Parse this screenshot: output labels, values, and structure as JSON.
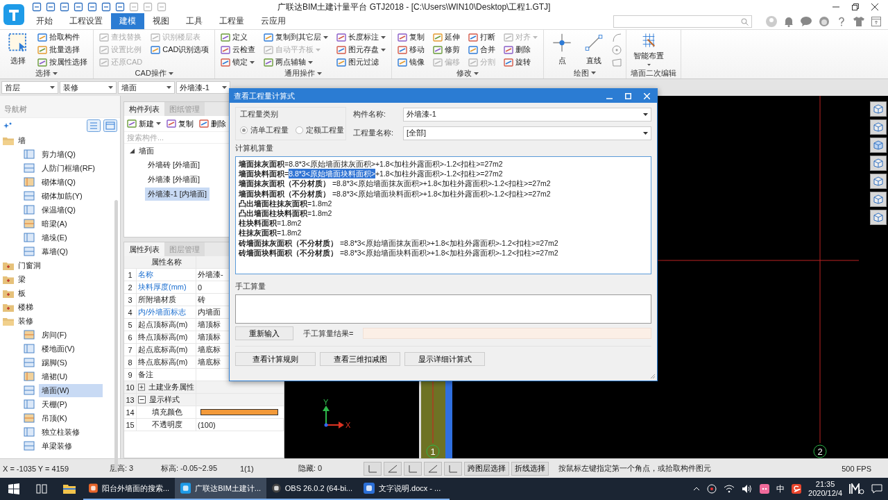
{
  "app": {
    "title": "广联达BIM土建计量平台 GTJ2018 - [C:\\Users\\WIN10\\Desktop\\工程1.GTJ]"
  },
  "menu_tabs": [
    {
      "label": "开始",
      "selected": false
    },
    {
      "label": "工程设置",
      "selected": false
    },
    {
      "label": "建模",
      "selected": true
    },
    {
      "label": "视图",
      "selected": false
    },
    {
      "label": "工具",
      "selected": false
    },
    {
      "label": "工程量",
      "selected": false
    },
    {
      "label": "云应用",
      "selected": false
    }
  ],
  "ribbon": [
    {
      "label": "选择",
      "dropdown": true,
      "big": [
        {
          "label": "选择",
          "dropdown": false
        }
      ],
      "small": [
        {
          "label": "拾取构件",
          "disabled": false,
          "dropdown": false
        },
        {
          "label": "批量选择",
          "disabled": false,
          "dropdown": false
        },
        {
          "label": "按属性选择",
          "disabled": false,
          "dropdown": false
        }
      ],
      "shape_tools": false
    },
    {
      "label": "CAD操作",
      "dropdown": true,
      "small": [
        {
          "label": "查找替换",
          "disabled": true,
          "dropdown": false
        },
        {
          "label": "设置比例",
          "disabled": true,
          "dropdown": false
        },
        {
          "label": "还原CAD",
          "disabled": true,
          "dropdown": false
        },
        {
          "label": "识别楼层表",
          "disabled": true,
          "dropdown": false
        },
        {
          "label": "CAD识别选项",
          "disabled": false,
          "dropdown": false
        }
      ],
      "shape_tools": false
    },
    {
      "label": "通用操作",
      "dropdown": true,
      "small": [
        {
          "label": "定义",
          "disabled": false,
          "dropdown": false
        },
        {
          "label": "云检查",
          "disabled": false,
          "dropdown": false
        },
        {
          "label": "锁定",
          "disabled": false,
          "dropdown": true
        },
        {
          "label": "复制到其它层",
          "disabled": false,
          "dropdown": true
        },
        {
          "label": "自动平齐板",
          "disabled": true,
          "dropdown": true
        },
        {
          "label": "两点辅轴",
          "disabled": false,
          "dropdown": true
        },
        {
          "label": "长度标注",
          "disabled": false,
          "dropdown": true
        },
        {
          "label": "图元存盘",
          "disabled": false,
          "dropdown": true
        },
        {
          "label": "图元过滤",
          "disabled": false,
          "dropdown": false
        }
      ],
      "shape_tools": false
    },
    {
      "label": "修改",
      "dropdown": true,
      "small": [
        {
          "label": "复制",
          "disabled": false,
          "dropdown": false
        },
        {
          "label": "移动",
          "disabled": false,
          "dropdown": false
        },
        {
          "label": "镜像",
          "disabled": false,
          "dropdown": false
        },
        {
          "label": "延伸",
          "disabled": false,
          "dropdown": false
        },
        {
          "label": "修剪",
          "disabled": false,
          "dropdown": false
        },
        {
          "label": "偏移",
          "disabled": true,
          "dropdown": false
        },
        {
          "label": "打断",
          "disabled": false,
          "dropdown": false
        },
        {
          "label": "合并",
          "disabled": false,
          "dropdown": false
        },
        {
          "label": "分割",
          "disabled": true,
          "dropdown": false
        },
        {
          "label": "对齐",
          "disabled": true,
          "dropdown": true
        },
        {
          "label": "删除",
          "disabled": false,
          "dropdown": false
        },
        {
          "label": "旋转",
          "disabled": false,
          "dropdown": false
        }
      ],
      "shape_tools": false
    },
    {
      "label": "绘图",
      "dropdown": true,
      "big": [
        {
          "label": "点",
          "dropdown": false
        },
        {
          "label": "直线",
          "dropdown": false
        }
      ],
      "shape_tools": true
    },
    {
      "label": "墙面二次编辑",
      "dropdown": false,
      "big": [
        {
          "label": "智能布置",
          "dropdown": true
        }
      ],
      "shape_tools": false
    }
  ],
  "selectors": [
    {
      "value": "首层"
    },
    {
      "value": "装修"
    },
    {
      "value": "墙面"
    },
    {
      "value": "外墙漆-1"
    }
  ],
  "nav_tree": {
    "title": "导航树",
    "items": [
      {
        "label": "墙",
        "expanded": true,
        "children": [
          {
            "label": "剪力墙(Q)",
            "selected": false
          },
          {
            "label": "人防门框墙(RF)",
            "selected": false
          },
          {
            "label": "砌体墙(Q)",
            "selected": false
          },
          {
            "label": "砌体加筋(Y)",
            "selected": false
          },
          {
            "label": "保温墙(Q)",
            "selected": false
          },
          {
            "label": "暗梁(A)",
            "selected": false
          },
          {
            "label": "墙垛(E)",
            "selected": false
          },
          {
            "label": "幕墙(Q)",
            "selected": false
          }
        ]
      },
      {
        "label": "门窗洞",
        "expanded": false
      },
      {
        "label": "梁",
        "expanded": false
      },
      {
        "label": "板",
        "expanded": false
      },
      {
        "label": "楼梯",
        "expanded": false
      },
      {
        "label": "装修",
        "expanded": true,
        "children": [
          {
            "label": "房间(F)",
            "selected": false
          },
          {
            "label": "楼地面(V)",
            "selected": false
          },
          {
            "label": "踢脚(S)",
            "selected": false
          },
          {
            "label": "墙裙(U)",
            "selected": false
          },
          {
            "label": "墙面(W)",
            "selected": true
          },
          {
            "label": "天棚(P)",
            "selected": false
          },
          {
            "label": "吊顶(K)",
            "selected": false
          },
          {
            "label": "独立柱装修",
            "selected": false
          },
          {
            "label": "单梁装修",
            "selected": false
          }
        ]
      }
    ]
  },
  "component_panel": {
    "tabs": [
      {
        "label": "构件列表",
        "selected": true
      },
      {
        "label": "图纸管理",
        "selected": false
      }
    ],
    "toolbar": [
      {
        "label": "新建",
        "dropdown": true
      },
      {
        "label": "复制",
        "dropdown": false
      },
      {
        "label": "删除",
        "dropdown": false
      }
    ],
    "search": {
      "placeholder": "搜索构件..."
    },
    "tree": [
      {
        "label": "墙面",
        "expanded": true,
        "children": [
          {
            "label": "外墙砖 [外墙面]",
            "selected": false
          },
          {
            "label": "外墙漆 [外墙面]",
            "selected": false
          },
          {
            "label": "外墙漆-1 [内墙面]",
            "selected": true
          }
        ]
      }
    ]
  },
  "property_panel": {
    "tabs": [
      {
        "label": "属性列表",
        "selected": true
      },
      {
        "label": "图层管理",
        "selected": false
      }
    ],
    "header": "属性名称",
    "rows": [
      {
        "kind": "attr",
        "num": "1",
        "name": "名称",
        "value": "外墙漆-",
        "emphasized": true
      },
      {
        "kind": "attr",
        "num": "2",
        "name": "块料厚度(mm)",
        "value": "0",
        "emphasized": true
      },
      {
        "kind": "attr",
        "num": "3",
        "name": "所附墙材质",
        "value": "砖",
        "emphasized": false
      },
      {
        "kind": "attr",
        "num": "4",
        "name": "内/外墙面标志",
        "value": "内墙面",
        "emphasized": true
      },
      {
        "kind": "attr",
        "num": "5",
        "name": "起点顶标高(m)",
        "value": "墙顶标",
        "emphasized": false
      },
      {
        "kind": "attr",
        "num": "6",
        "name": "终点顶标高(m)",
        "value": "墙顶标",
        "emphasized": false
      },
      {
        "kind": "attr",
        "num": "7",
        "name": "起点底标高(m)",
        "value": "墙底标",
        "emphasized": false
      },
      {
        "kind": "attr",
        "num": "8",
        "name": "终点底标高(m)",
        "value": "墙底标",
        "emphasized": false
      },
      {
        "kind": "attr",
        "num": "9",
        "name": "备注",
        "emphasized": false
      },
      {
        "kind": "group",
        "num": "10",
        "name": "土建业务属性",
        "expanded": false
      },
      {
        "kind": "group",
        "num": "13",
        "name": "显示样式",
        "expanded": true
      },
      {
        "kind": "color",
        "num": "14",
        "name": "填充颜色",
        "color": "#f39a3a"
      },
      {
        "kind": "sub",
        "num": "15",
        "name": "不透明度",
        "value": "(100)"
      }
    ]
  },
  "canvas": {
    "axis_labels": [
      "1",
      "2"
    ],
    "ucs": {
      "x": "X",
      "y": "Y"
    }
  },
  "dialog": {
    "title": "查看工程量计算式",
    "category": {
      "label": "工程量类别",
      "options": [
        {
          "label": "清单工程量",
          "selected": true
        },
        {
          "label": "定额工程量",
          "selected": false
        }
      ]
    },
    "fields": [
      {
        "label": "构件名称:",
        "value": "外墙漆-1"
      },
      {
        "label": "工程量名称:",
        "value": "[全部]"
      }
    ],
    "computed_label": "计算机算量",
    "computed_lines": [
      {
        "label": "墙面抹灰面积",
        "segments": [
          {
            "text": "=8.8*3<原始墙面抹灰面积>+1.8<加柱外露面积>-1.2<扣柱>=27m2",
            "selected": false
          }
        ]
      },
      {
        "label": "墙面块料面积",
        "segments": [
          {
            "text": "=",
            "selected": false
          },
          {
            "text": "8.8*3<原始墙面块料面积>",
            "selected": true
          },
          {
            "text": "+1.8<加柱外露面积>-1.2<扣柱>=27m2",
            "selected": false
          }
        ]
      },
      {
        "label": "墙面抹灰面积（不分材质）",
        "segments": [
          {
            "text": " =8.8*3<原始墙面抹灰面积>+1.8<加柱外露面积>-1.2<扣柱>=27m2",
            "selected": false
          }
        ]
      },
      {
        "label": "墙面块料面积（不分材质）",
        "segments": [
          {
            "text": " =8.8*3<原始墙面块料面积>+1.8<加柱外露面积>-1.2<扣柱>=27m2",
            "selected": false
          }
        ]
      },
      {
        "label": "凸出墙面柱抹灰面积",
        "segments": [
          {
            "text": "=1.8m2",
            "selected": false
          }
        ]
      },
      {
        "label": "凸出墙面柱块料面积",
        "segments": [
          {
            "text": "=1.8m2",
            "selected": false
          }
        ]
      },
      {
        "label": "柱块料面积",
        "segments": [
          {
            "text": "=1.8m2",
            "selected": false
          }
        ]
      },
      {
        "label": "柱抹灰面积",
        "segments": [
          {
            "text": "=1.8m2",
            "selected": false
          }
        ]
      },
      {
        "label": "砖墙面抹灰面积（不分材质）",
        "segments": [
          {
            "text": " =8.8*3<原始墙面抹灰面积>+1.8<加柱外露面积>-1.2<扣柱>=27m2",
            "selected": false
          }
        ]
      },
      {
        "label": "砖墙面块料面积（不分材质）",
        "segments": [
          {
            "text": " =8.8*3<原始墙面块料面积>+1.8<加柱外露面积>-1.2<扣柱>=27m2",
            "selected": false
          }
        ]
      }
    ],
    "manual_label": "手工算量",
    "reset_button": "重新输入",
    "result_label": "手工算量结果=",
    "buttons": [
      "查看计算规则",
      "查看三维扣减图",
      "显示详细计算式"
    ]
  },
  "status_bar": {
    "coords": "X = -1035 Y = 4159",
    "floor_height": "层高:  3",
    "elevation": "标高:  -0.05~2.95",
    "count": "1(1)",
    "hidden": "隐藏:  0",
    "buttons": [
      "跨图层选择",
      "折线选择"
    ],
    "hint": "按鼠标左键指定第一个角点，或拾取构件图元",
    "fps": "500 FPS"
  },
  "taskbar": {
    "apps": [
      {
        "label": "阳台外墙面的搜索...",
        "selected": false
      },
      {
        "label": "广联达BIM土建计...",
        "selected": true
      },
      {
        "label": "OBS 26.0.2 (64-bi...",
        "selected": false
      },
      {
        "label": "文字说明.docx - ...",
        "selected": false
      }
    ],
    "ime": "中",
    "time": "21:35",
    "date": "2020/12/4"
  }
}
